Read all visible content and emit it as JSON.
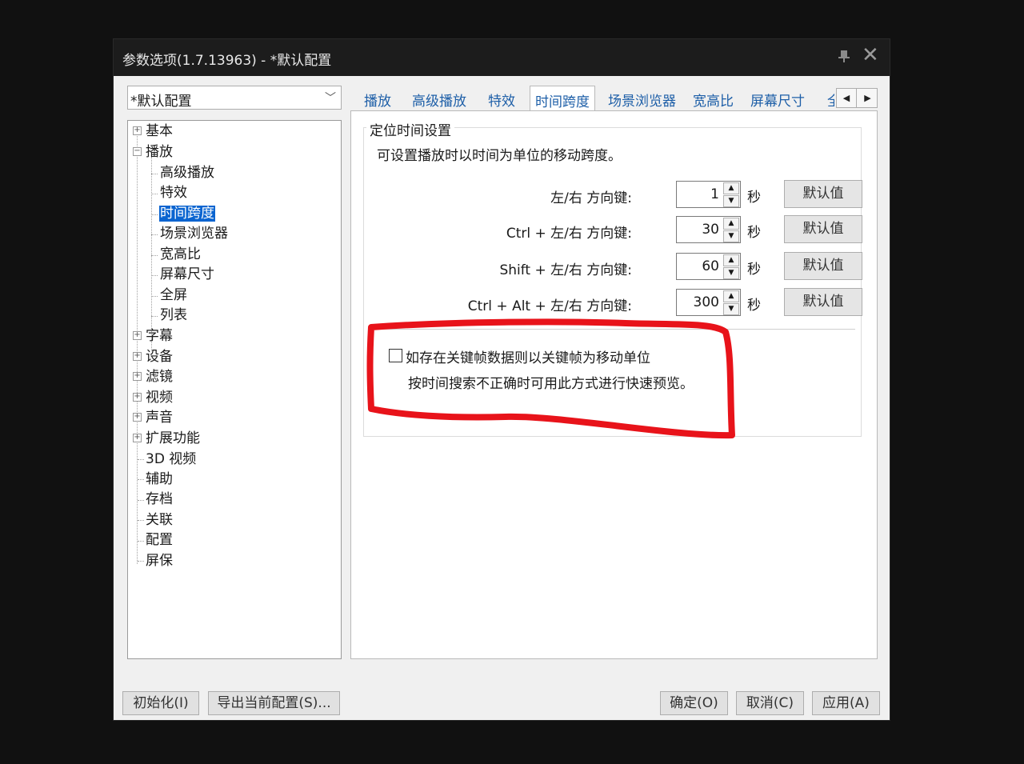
{
  "window": {
    "title": "参数选项(1.7.13963) - *默认配置"
  },
  "profile_select": {
    "value": "*默认配置"
  },
  "tree": {
    "items": [
      {
        "label": "基本",
        "expander": "⊞"
      },
      {
        "label": "播放",
        "expander": "⊟"
      },
      {
        "label": "高级播放"
      },
      {
        "label": "特效"
      },
      {
        "label": "时间跨度"
      },
      {
        "label": "场景浏览器"
      },
      {
        "label": "宽高比"
      },
      {
        "label": "屏幕尺寸"
      },
      {
        "label": "全屏"
      },
      {
        "label": "列表"
      },
      {
        "label": "字幕",
        "expander": "⊞"
      },
      {
        "label": "设备",
        "expander": "⊞"
      },
      {
        "label": "滤镜",
        "expander": "⊞"
      },
      {
        "label": "视频",
        "expander": "⊞"
      },
      {
        "label": "声音",
        "expander": "⊞"
      },
      {
        "label": "扩展功能",
        "expander": "⊞"
      },
      {
        "label": "3D 视频"
      },
      {
        "label": "辅助"
      },
      {
        "label": "存档"
      },
      {
        "label": "关联"
      },
      {
        "label": "配置"
      },
      {
        "label": "屏保"
      }
    ]
  },
  "tabs": [
    "播放",
    "高级播放",
    "特效",
    "时间跨度",
    "场景浏览器",
    "宽高比",
    "屏幕尺寸",
    "全"
  ],
  "group": {
    "title": "定位时间设置",
    "description": "可设置播放时以时间为单位的移动跨度。",
    "rows": [
      {
        "label": "左/右 方向键:",
        "value": "1",
        "unit": "秒",
        "default_label": "默认值"
      },
      {
        "label": "Ctrl + 左/右 方向键:",
        "value": "30",
        "unit": "秒",
        "default_label": "默认值"
      },
      {
        "label": "Shift + 左/右 方向键:",
        "value": "60",
        "unit": "秒",
        "default_label": "默认值"
      },
      {
        "label": "Ctrl + Alt + 左/右 方向键:",
        "value": "300",
        "unit": "秒",
        "default_label": "默认值"
      }
    ],
    "keyframe_checkbox": {
      "label": "如存在关键帧数据则以关键帧为移动单位",
      "sublabel": "按时间搜索不正确时可用此方式进行快速预览。",
      "checked": false
    }
  },
  "annotation_color": "#e8131a",
  "buttons": {
    "init": "初始化(I)",
    "export": "导出当前配置(S)...",
    "ok": "确定(O)",
    "cancel": "取消(C)",
    "apply": "应用(A)"
  }
}
